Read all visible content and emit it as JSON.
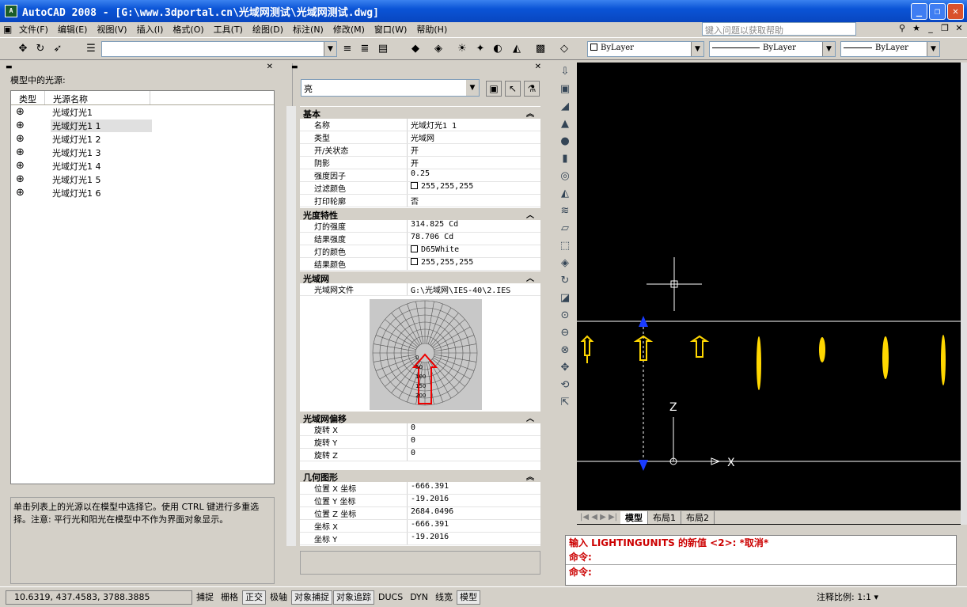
{
  "app": {
    "title": "AutoCAD 2008 - [G:\\www.3dportal.cn\\光域网测试\\光域网测试.dwg]",
    "icon_text": "A"
  },
  "window_buttons": {
    "minimize": "_",
    "restore": "❐",
    "close": "✕"
  },
  "menu": {
    "items": [
      "文件(F)",
      "编辑(E)",
      "视图(V)",
      "插入(I)",
      "格式(O)",
      "工具(T)",
      "绘图(D)",
      "标注(N)",
      "修改(M)",
      "窗口(W)",
      "帮助(H)"
    ],
    "help_placeholder": "键入问题以获取帮助"
  },
  "toolbar": {
    "linetype": "ByLayer",
    "lineweight": "ByLayer",
    "color": "ByLayer"
  },
  "lights_panel": {
    "title": "模型中的光源:",
    "col_type": "类型",
    "col_name": "光源名称",
    "lights": [
      "光域灯光1",
      "光域灯光1 1",
      "光域灯光1 2",
      "光域灯光1 3",
      "光域灯光1 4",
      "光域灯光1 5",
      "光域灯光1 6"
    ],
    "selected_index": 1,
    "description": "单击列表上的光源以在模型中选择它。使用 CTRL 键进行多重选择。注意: 平行光和阳光在模型中不作为界面对象显示。"
  },
  "properties": {
    "selection": "亮",
    "sections": {
      "basic": "基本",
      "photometric": "光度特性",
      "web": "光域网",
      "web_offset": "光域网偏移",
      "geometry": "几何图形"
    },
    "basic": [
      {
        "k": "名称",
        "v": "光域灯光1 1"
      },
      {
        "k": "类型",
        "v": "光域网"
      },
      {
        "k": "开/关状态",
        "v": "开"
      },
      {
        "k": "阴影",
        "v": "开"
      },
      {
        "k": "强度因子",
        "v": "0.25"
      },
      {
        "k": "过滤颜色",
        "v": "255,255,255",
        "swatch": true
      },
      {
        "k": "打印轮廓",
        "v": "否"
      }
    ],
    "photometric": [
      {
        "k": "灯的强度",
        "v": "314.825 Cd"
      },
      {
        "k": "结果强度",
        "v": "78.706 Cd"
      },
      {
        "k": "灯的颜色",
        "v": "D65White",
        "swatch": true
      },
      {
        "k": "结果颜色",
        "v": "255,255,255",
        "swatch": true
      }
    ],
    "web": [
      {
        "k": "光域网文件",
        "v": "G:\\光域网\\IES-40\\2.IES"
      }
    ],
    "web_offset": [
      {
        "k": "旋转 X",
        "v": "0"
      },
      {
        "k": "旋转 Y",
        "v": "0"
      },
      {
        "k": "旋转 Z",
        "v": "0"
      }
    ],
    "geometry": [
      {
        "k": "位置 X 坐标",
        "v": "-666.391"
      },
      {
        "k": "位置 Y 坐标",
        "v": "-19.2016"
      },
      {
        "k": "位置 Z 坐标",
        "v": "2684.0496"
      },
      {
        "k": "坐标 X",
        "v": "-666.391"
      },
      {
        "k": "坐标 Y",
        "v": "-19.2016"
      }
    ],
    "ies_ticks": [
      "0",
      "50",
      "100",
      "150",
      "200"
    ]
  },
  "drawing": {
    "z_label": "Z",
    "x_label": "X"
  },
  "layout_tabs": [
    "模型",
    "布局1",
    "布局2"
  ],
  "command": {
    "line1": "输入 LIGHTINGUNITS 的新值 <2>: *取消*",
    "line2": "命令:",
    "prompt": "命令:"
  },
  "status": {
    "coords": "10.6319,  437.4583, 3788.3885",
    "buttons": [
      "捕捉",
      "栅格",
      "正交",
      "极轴",
      "对象捕捉",
      "对象追踪",
      "DUCS",
      "DYN",
      "线宽",
      "模型"
    ],
    "on": [
      2,
      4,
      5,
      9
    ],
    "scale": "注释比例: 1:1 ▾"
  }
}
